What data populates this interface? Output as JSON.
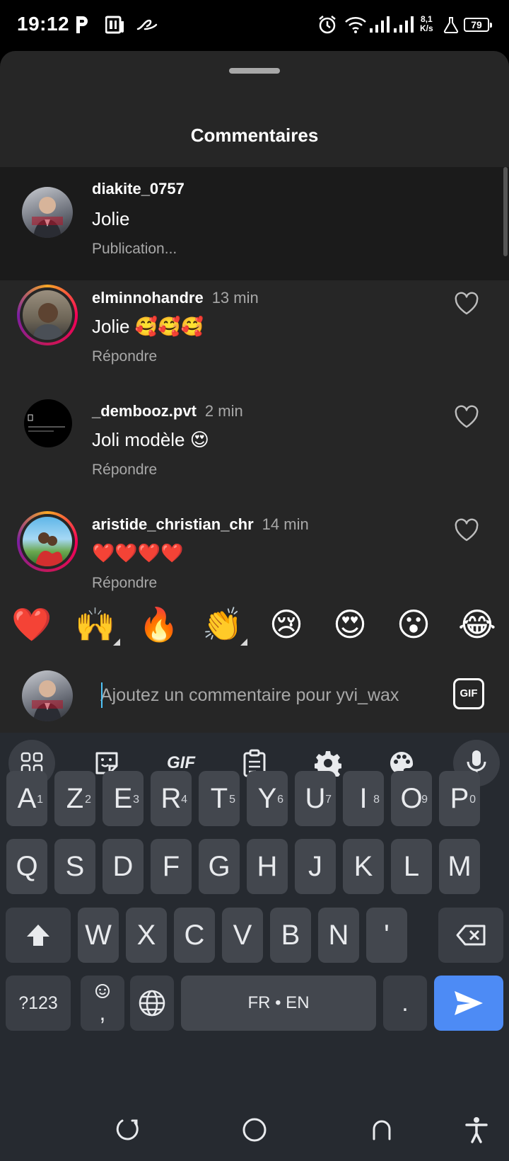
{
  "status_bar": {
    "time": "19:12",
    "net_speed_value": "8,1",
    "net_speed_unit": "K/s",
    "battery": "79",
    "icons": [
      "p-app-icon",
      "news-app-icon",
      "swirl-app-icon",
      "alarm-icon",
      "wifi-icon",
      "signal-icon",
      "signal-icon",
      "flask-icon",
      "battery-icon"
    ]
  },
  "sheet": {
    "title": "Commentaires"
  },
  "comments": [
    {
      "username": "diakite_0757",
      "time": "",
      "text": "Jolie",
      "action": "Publication...",
      "pending": true
    },
    {
      "username": "elminnohandre",
      "time": "13 min",
      "text": "Jolie 🥰🥰🥰",
      "action": "Répondre"
    },
    {
      "username": "_dembooz.pvt",
      "time": "2 min",
      "text": "Joli modèle 😍",
      "action": "Répondre"
    },
    {
      "username": "aristide_christian_chr",
      "time": "14 min",
      "text": "❤️❤️❤️❤️",
      "action": "Répondre"
    }
  ],
  "reactions": [
    "❤️",
    "🙌",
    "🔥",
    "👏",
    "😢",
    "😍",
    "😮",
    "😂"
  ],
  "comment_input": {
    "placeholder": "Ajoutez un commentaire pour yvi_wax",
    "gif_label": "GIF"
  },
  "keyboard": {
    "toolbar": [
      "apps-grid-icon",
      "sticker-icon",
      "gif-icon",
      "clipboard-icon",
      "settings-icon",
      "palette-icon",
      "microphone-icon"
    ],
    "toolbar_gif_label": "GIF",
    "row1": [
      {
        "k": "A",
        "h": "1"
      },
      {
        "k": "Z",
        "h": "2"
      },
      {
        "k": "E",
        "h": "3"
      },
      {
        "k": "R",
        "h": "4"
      },
      {
        "k": "T",
        "h": "5"
      },
      {
        "k": "Y",
        "h": "6"
      },
      {
        "k": "U",
        "h": "7"
      },
      {
        "k": "I",
        "h": "8"
      },
      {
        "k": "O",
        "h": "9"
      },
      {
        "k": "P",
        "h": "0"
      }
    ],
    "row2": [
      "Q",
      "S",
      "D",
      "F",
      "G",
      "H",
      "J",
      "K",
      "L",
      "M"
    ],
    "row3": [
      "W",
      "X",
      "C",
      "V",
      "B",
      "N",
      "'"
    ],
    "symbols_label": "?123",
    "emoji_comma_label": ",",
    "space_label": "FR • EN",
    "period_label": "."
  },
  "navigation": [
    "recents-icon",
    "home-icon",
    "back-icon",
    "accessibility-icon"
  ]
}
